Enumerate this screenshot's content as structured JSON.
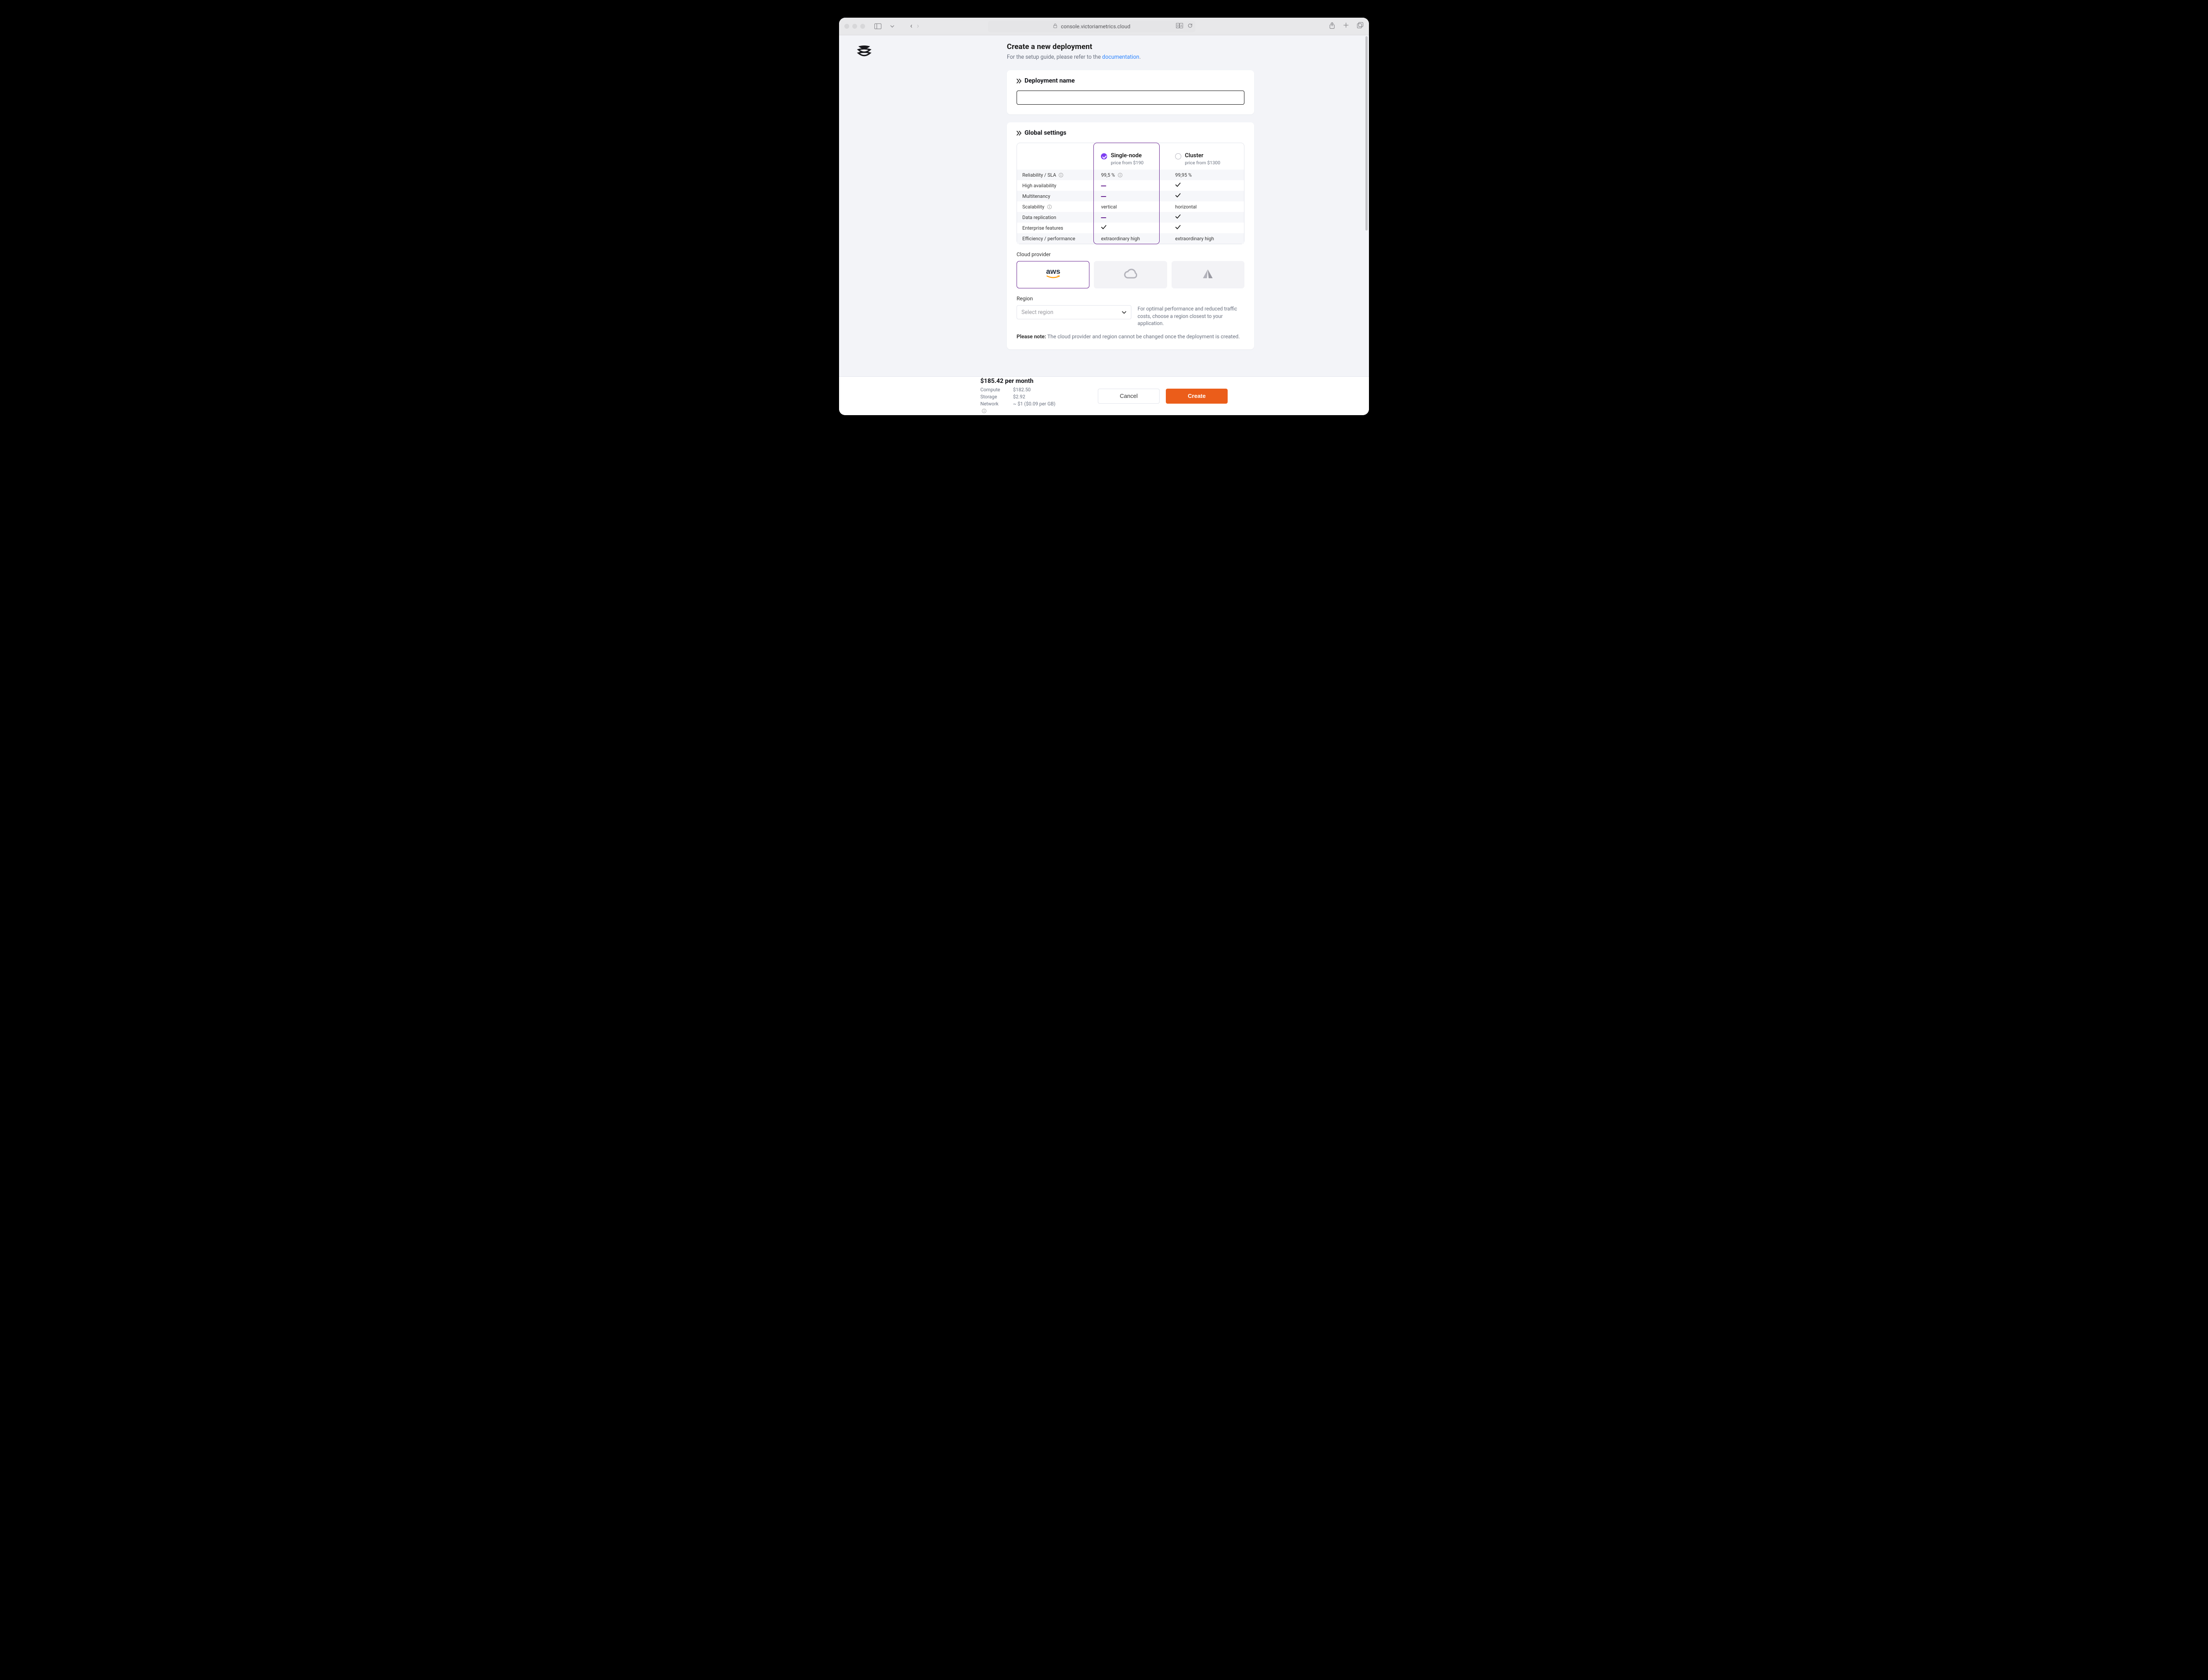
{
  "browser": {
    "url": "console.victoriametrics.cloud"
  },
  "page": {
    "title": "Create a new deployment",
    "subtitle_pre": "For the setup guide, please refer to the ",
    "subtitle_link": "documentation",
    "subtitle_post": "."
  },
  "sections": {
    "name": {
      "title": "Deployment name",
      "value": ""
    },
    "global": {
      "title": "Global settings"
    }
  },
  "plans": [
    {
      "name": "Single-node",
      "price": "price from $190",
      "selected": true,
      "values": {
        "sla": "99,5 %",
        "ha": "dash",
        "mt": "dash",
        "scal": "vertical",
        "repl": "dash",
        "ent": "check",
        "eff": "extraordinary high"
      }
    },
    {
      "name": "Cluster",
      "price": "price from $1300",
      "selected": false,
      "values": {
        "sla": "99,95 %",
        "ha": "check",
        "mt": "check",
        "scal": "horizontal",
        "repl": "check",
        "ent": "check",
        "eff": "extraordinary high"
      }
    }
  ],
  "plan_rows": [
    {
      "key": "sla",
      "label": "Reliability / SLA",
      "info": true
    },
    {
      "key": "ha",
      "label": "High availability"
    },
    {
      "key": "mt",
      "label": "Multitenancy"
    },
    {
      "key": "scal",
      "label": "Scalability",
      "info": true
    },
    {
      "key": "repl",
      "label": "Data replication"
    },
    {
      "key": "ent",
      "label": "Enterprise features"
    },
    {
      "key": "eff",
      "label": "Efficiency / performance"
    }
  ],
  "cloud": {
    "label": "Cloud provider",
    "providers": [
      {
        "id": "aws",
        "name": "AWS",
        "selected": true
      },
      {
        "id": "gcp",
        "name": "GCP",
        "selected": false
      },
      {
        "id": "azure",
        "name": "Azure",
        "selected": false
      }
    ]
  },
  "region": {
    "label": "Region",
    "placeholder": "Select region",
    "help": "For optimal performance and reduced traffic costs, choose a region closest to your application."
  },
  "note": {
    "bold": "Please note:",
    "text": " The cloud provider and region cannot be changed once the deployment is created."
  },
  "footer": {
    "total": "$185.42 per month",
    "lines": [
      {
        "label": "Compute",
        "value": "$182.50"
      },
      {
        "label": "Storage",
        "value": "$2.92"
      },
      {
        "label": "Network",
        "value": "~ $1 ($0.09 per GB)",
        "info": true
      }
    ],
    "cancel": "Cancel",
    "create": "Create"
  }
}
